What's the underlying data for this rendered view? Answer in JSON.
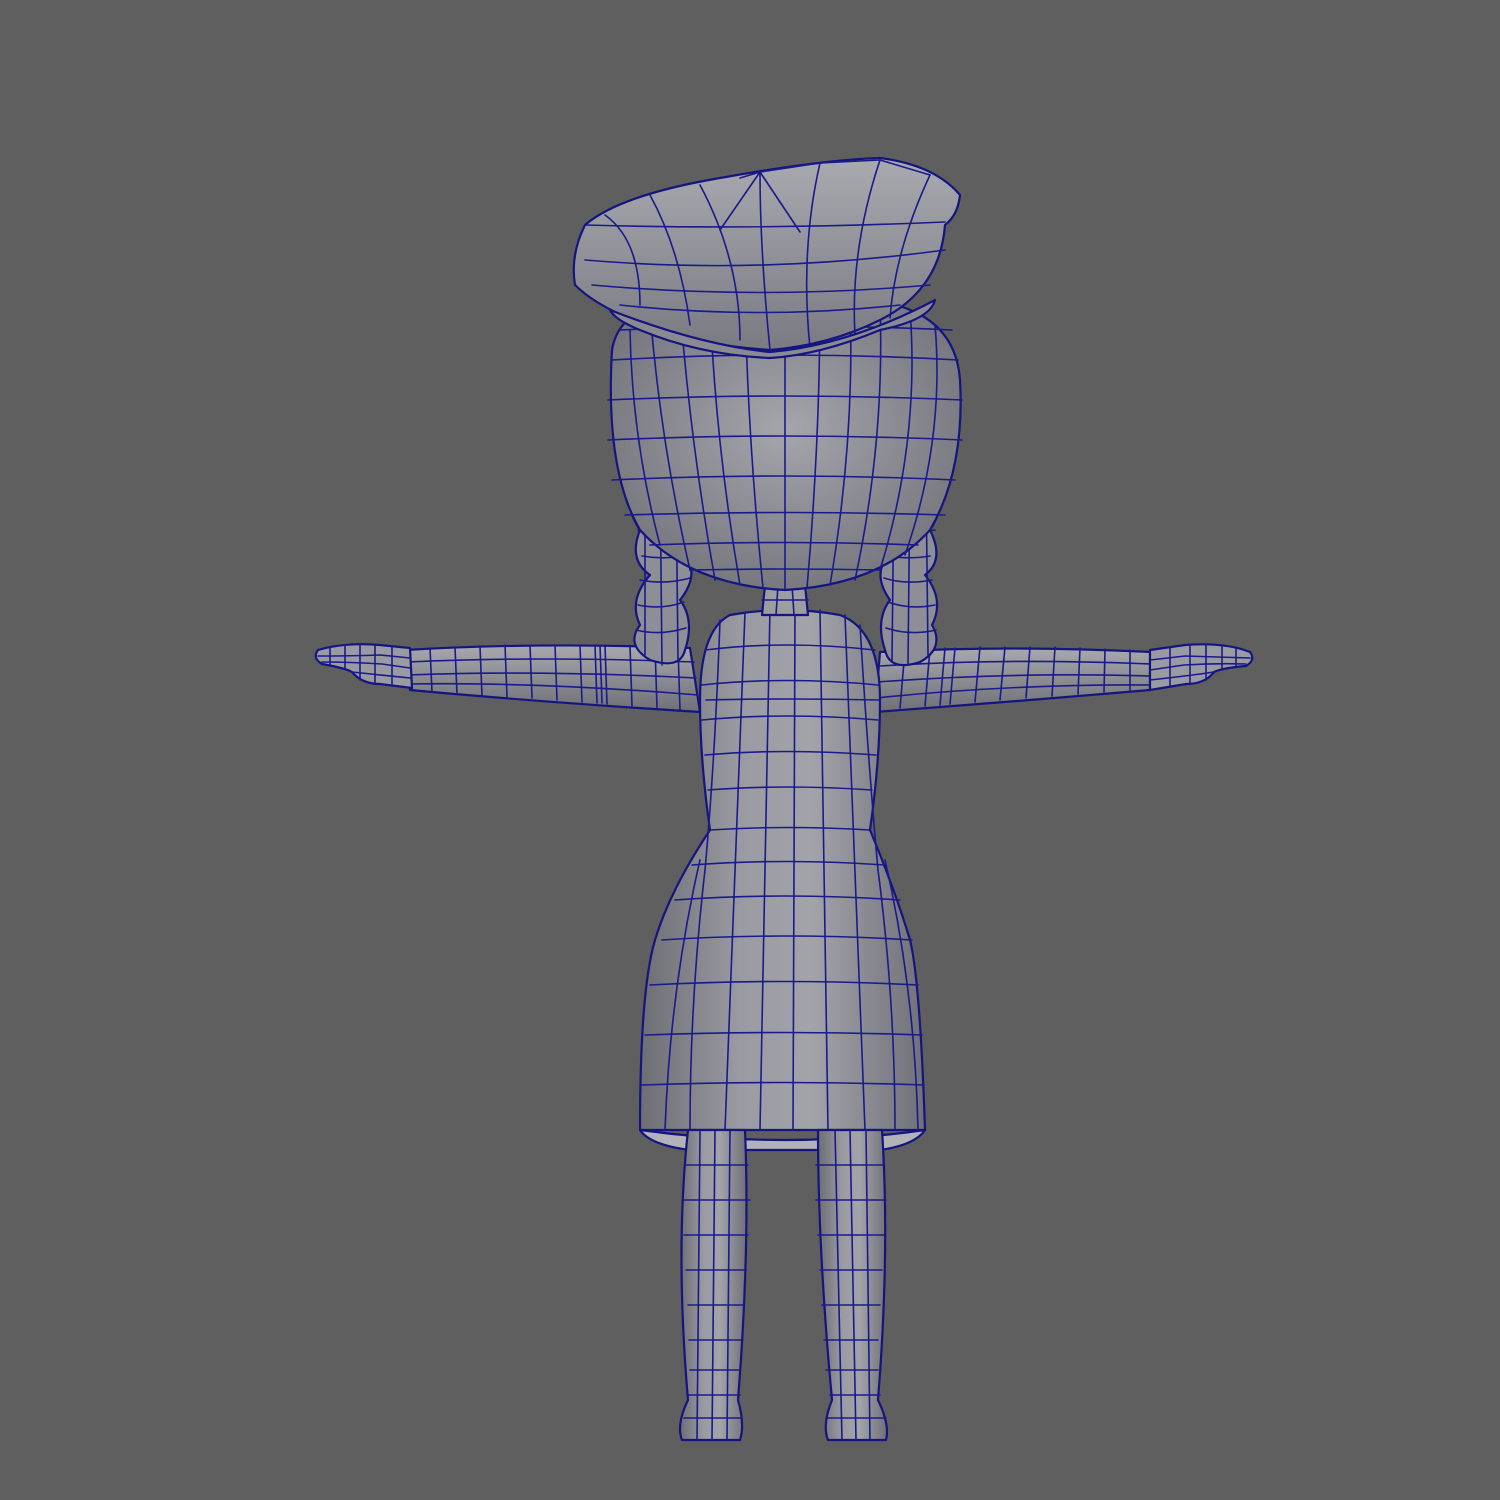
{
  "viewport": {
    "background_color": "#5f5f5f",
    "mesh_fill_color": "#8f8f96",
    "wire_color": "#1a1a8c",
    "subject": "character-wireframe"
  }
}
